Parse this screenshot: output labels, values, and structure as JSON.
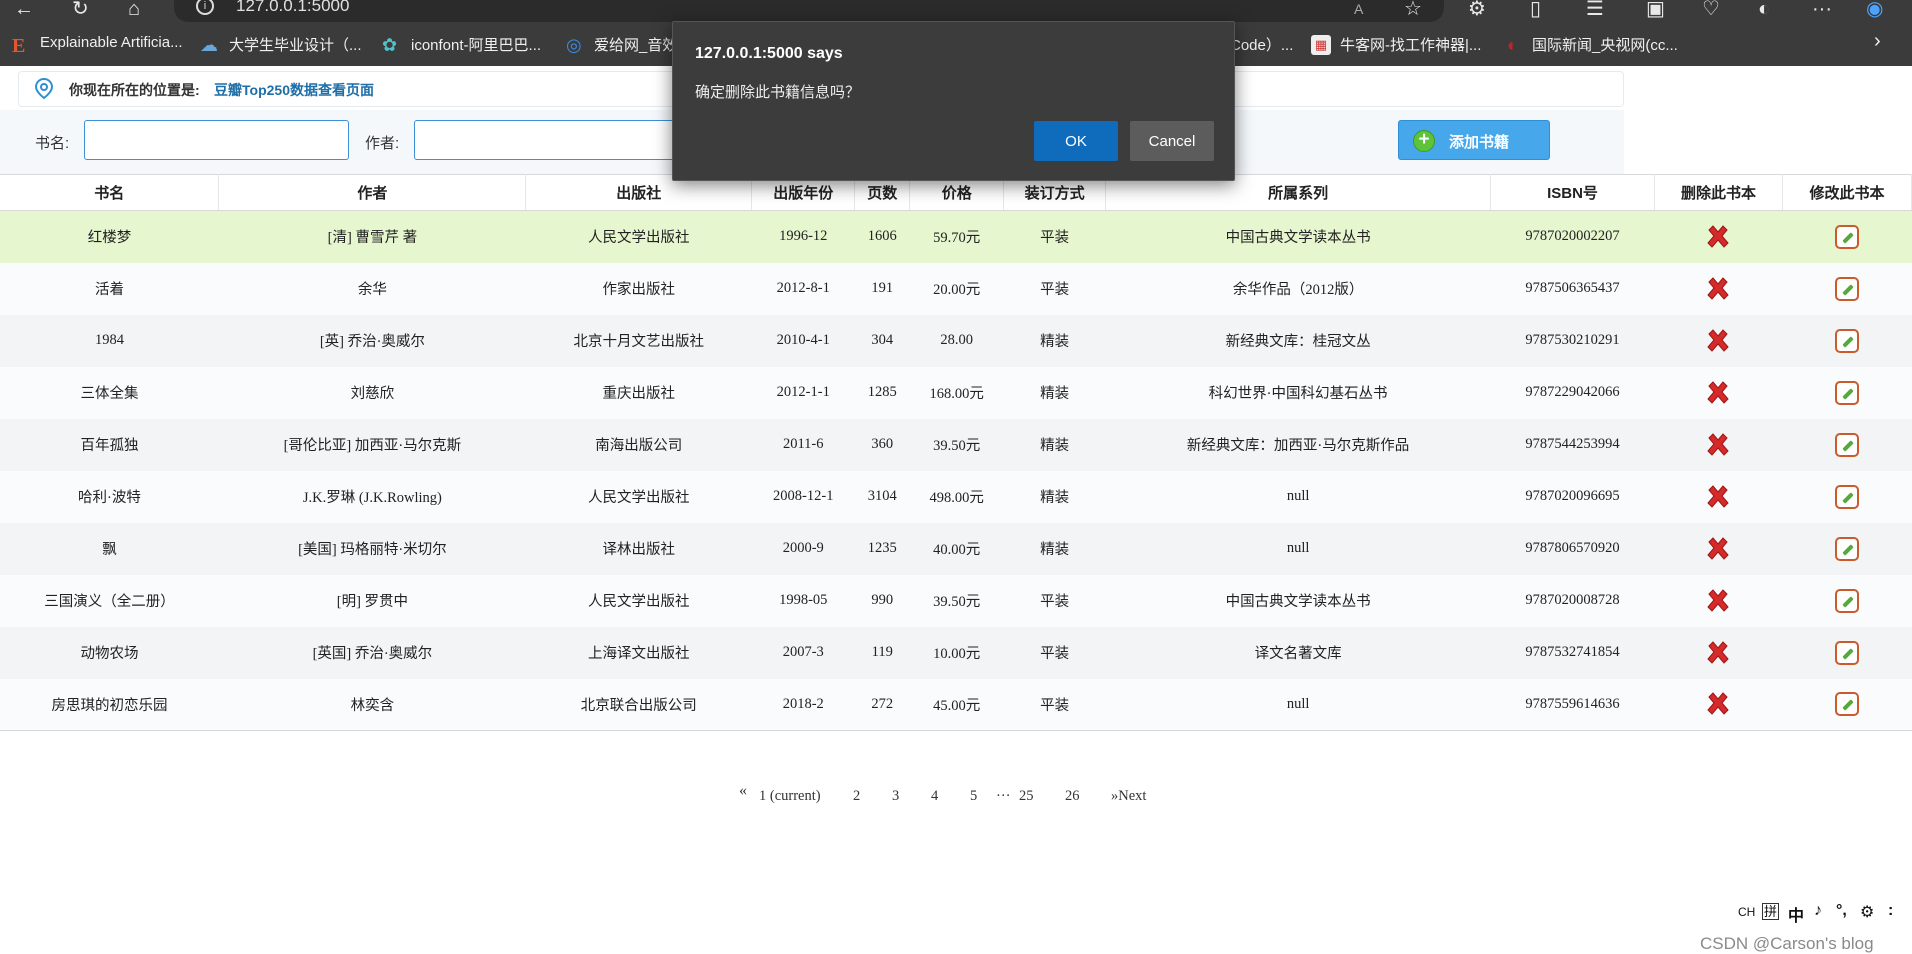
{
  "browser": {
    "url": "127.0.0.1:5000",
    "bookmarks": [
      {
        "label": "Explainable Artificia...",
        "icon": "e-icon"
      },
      {
        "label": "大学生毕业设计（...",
        "icon": "cloud-icon"
      },
      {
        "label": "iconfont-阿里巴巴...",
        "icon": "iconfont-icon"
      },
      {
        "label": "爱给网_音效",
        "icon": "aigei-icon"
      },
      {
        "label": "Code）...",
        "icon": ""
      },
      {
        "label": "牛客网-找工作神器|...",
        "icon": "nowcoder-icon"
      },
      {
        "label": "国际新闻_央视网(cc...",
        "icon": "cctv-icon"
      }
    ]
  },
  "location": {
    "prefix": "你现在所在的位置是:",
    "page": "豆瓣Top250数据查看页面"
  },
  "search": {
    "book_label": "书名:",
    "author_label": "作者:",
    "book_value": "",
    "author_value": "",
    "add_button": "添加书籍"
  },
  "table": {
    "headers": [
      "书名",
      "作者",
      "出版社",
      "出版年份",
      "页数",
      "价格",
      "装订方式",
      "所属系列",
      "ISBN号",
      "删除此书本",
      "修改此书本"
    ],
    "rows": [
      [
        "红楼梦",
        "[清] 曹雪芹 著",
        "人民文学出版社",
        "1996-12",
        "1606",
        "59.70元",
        "平装",
        "中国古典文学读本丛书",
        "9787020002207"
      ],
      [
        "活着",
        "余华",
        "作家出版社",
        "2012-8-1",
        "191",
        "20.00元",
        "平装",
        "余华作品（2012版）",
        "9787506365437"
      ],
      [
        "1984",
        "[英] 乔治·奥威尔",
        "北京十月文艺出版社",
        "2010-4-1",
        "304",
        "28.00",
        "精装",
        "新经典文库：桂冠文丛",
        "9787530210291"
      ],
      [
        "三体全集",
        "刘慈欣",
        "重庆出版社",
        "2012-1-1",
        "1285",
        "168.00元",
        "精装",
        "科幻世界·中国科幻基石丛书",
        "9787229042066"
      ],
      [
        "百年孤独",
        "[哥伦比亚] 加西亚·马尔克斯",
        "南海出版公司",
        "2011-6",
        "360",
        "39.50元",
        "精装",
        "新经典文库：加西亚·马尔克斯作品",
        "9787544253994"
      ],
      [
        "哈利·波特",
        "J.K.罗琳 (J.K.Rowling)",
        "人民文学出版社",
        "2008-12-1",
        "3104",
        "498.00元",
        "精装",
        "null",
        "9787020096695"
      ],
      [
        "飘",
        "[美国] 玛格丽特·米切尔",
        "译林出版社",
        "2000-9",
        "1235",
        "40.00元",
        "精装",
        "null",
        "9787806570920"
      ],
      [
        "三国演义（全二册）",
        "[明] 罗贯中",
        "人民文学出版社",
        "1998-05",
        "990",
        "39.50元",
        "平装",
        "中国古典文学读本丛书",
        "9787020008728"
      ],
      [
        "动物农场",
        "[英国] 乔治·奥威尔",
        "上海译文出版社",
        "2007-3",
        "119",
        "10.00元",
        "平装",
        "译文名著文库",
        "9787532741854"
      ],
      [
        "房思琪的初恋乐园",
        "林奕含",
        "北京联合出版公司",
        "2018-2",
        "272",
        "45.00元",
        "平装",
        "null",
        "9787559614636"
      ]
    ]
  },
  "pagination": {
    "prev": "«",
    "current": "1 (current)",
    "pages": [
      "2",
      "3",
      "4",
      "5"
    ],
    "ellipsis": "…",
    "tail": [
      "25",
      "26"
    ],
    "next": "»Next"
  },
  "dialog": {
    "title": "127.0.0.1:5000 says",
    "message": "确定删除此书籍信息吗？",
    "ok": "OK",
    "cancel": "Cancel"
  },
  "ime": {
    "items": [
      "CH",
      "拼",
      "中",
      "♪",
      "°,",
      "⚙",
      ":"
    ]
  },
  "watermark": "CSDN @Carson's  blog",
  "colors": {
    "accent": "#0f6cbd",
    "link": "#1e6ea8",
    "highlight_row": "#e6f6cf",
    "delete": "#d42a2a",
    "edit": "#c95c2a"
  }
}
